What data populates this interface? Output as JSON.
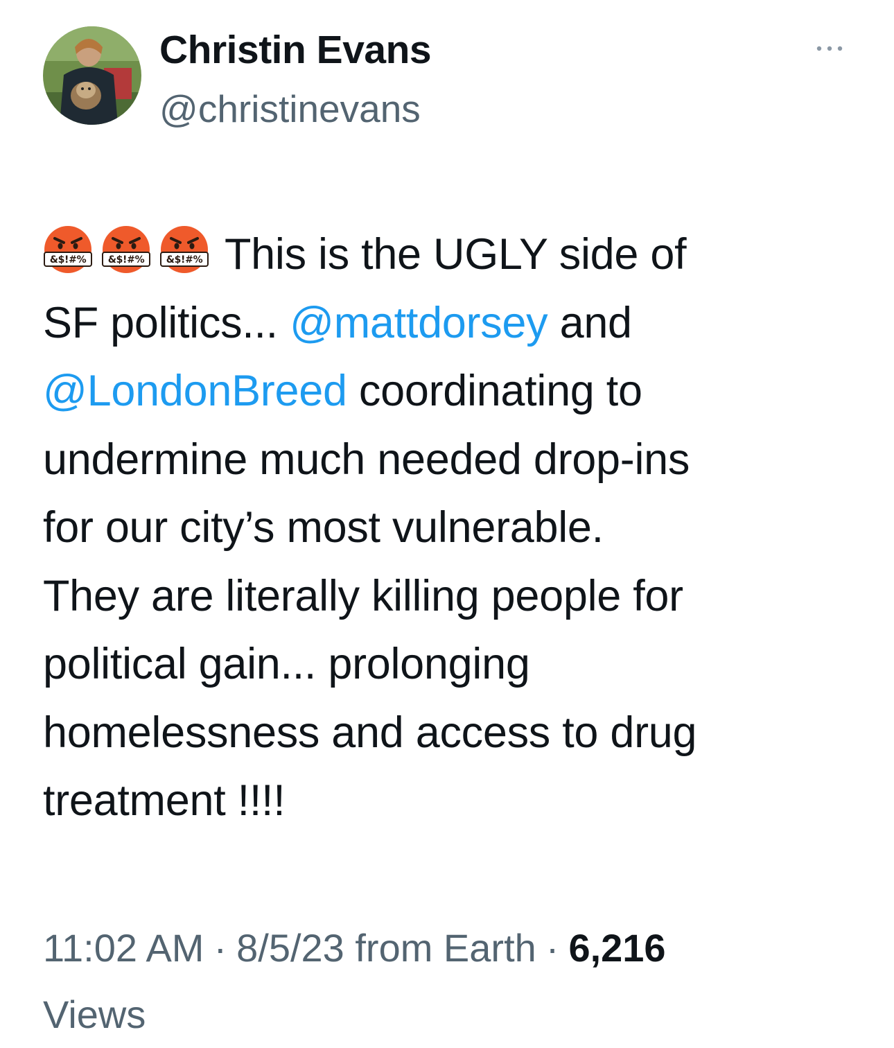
{
  "author": {
    "display_name": "Christin Evans",
    "handle": "@christinevans",
    "avatar_icon": "profile-photo-woman-with-dog"
  },
  "more_icon": "more-options-icon",
  "tweet": {
    "emojis": [
      "pouting-face-with-symbols",
      "pouting-face-with-symbols",
      "pouting-face-with-symbols"
    ],
    "emoji_symbol_text": "&$!#%",
    "line1_text": "This is the UGLY side of",
    "line2_text": "SF politics... ",
    "mention1": "@mattdorsey",
    "line2_after": " and",
    "mention2": "@LondonBreed",
    "line3_after": " coordinating to",
    "line4_text": "undermine much needed drop-ins",
    "line5_text": "for our city’s most vulnerable.",
    "line6_text": "They are literally killing people for",
    "line7_text": "political gain... prolonging",
    "line8_text": "homelessness and access to drug",
    "line9_text": "treatment !!!!"
  },
  "meta": {
    "time": "11:02 AM",
    "separator": "·",
    "date": "8/5/23",
    "source": "from Earth",
    "views_count": "6,216",
    "views_label": "Views"
  },
  "colors": {
    "text": "#0f1419",
    "secondary": "#536471",
    "link": "#1d9bf0",
    "emoji_face": "#e8532c"
  }
}
